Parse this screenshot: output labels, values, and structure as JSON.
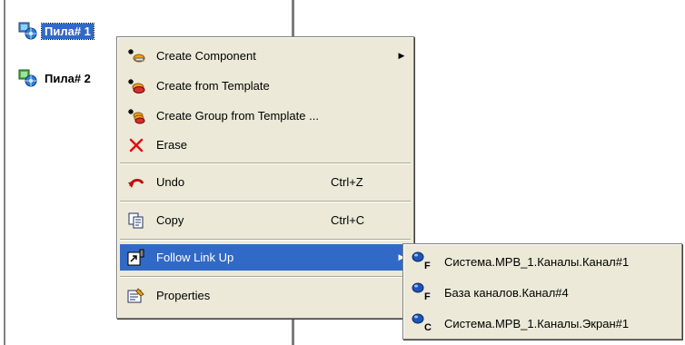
{
  "tree": {
    "items": [
      {
        "label": "Пила# 1",
        "icon": "component-icon",
        "selected": true
      },
      {
        "label": "Пила# 2",
        "icon": "component-icon",
        "selected": false
      }
    ]
  },
  "context_menu": {
    "items": [
      {
        "label": "Create Component",
        "icon": "create-component-icon",
        "shortcut": "",
        "has_submenu": true
      },
      {
        "label": "Create from Template",
        "icon": "create-template-icon",
        "shortcut": "",
        "has_submenu": false
      },
      {
        "label": "Create Group from Template ...",
        "icon": "create-group-icon",
        "shortcut": "",
        "has_submenu": false
      },
      {
        "label": "Erase",
        "icon": "erase-icon",
        "shortcut": "",
        "has_submenu": false
      },
      {
        "label": "Undo",
        "icon": "undo-icon",
        "shortcut": "Ctrl+Z",
        "has_submenu": false
      },
      {
        "label": "Copy",
        "icon": "copy-icon",
        "shortcut": "Ctrl+C",
        "has_submenu": false
      },
      {
        "label": "Follow Link Up",
        "icon": "follow-link-icon",
        "shortcut": "",
        "has_submenu": true,
        "highlighted": true
      },
      {
        "label": "Properties",
        "icon": "properties-icon",
        "shortcut": "",
        "has_submenu": false
      }
    ]
  },
  "submenu": {
    "items": [
      {
        "label": "Система.МРВ_1.Каналы.Канал#1",
        "letter": "F",
        "icon": "link-node-icon"
      },
      {
        "label": "База каналов.Канал#4",
        "letter": "F",
        "icon": "link-node-icon"
      },
      {
        "label": "Система.МРВ_1.Каналы.Экран#1",
        "letter": "C",
        "icon": "link-node-icon"
      }
    ]
  },
  "colors": {
    "highlight": "#3169c6",
    "menu_bg": "#ece9d8"
  }
}
